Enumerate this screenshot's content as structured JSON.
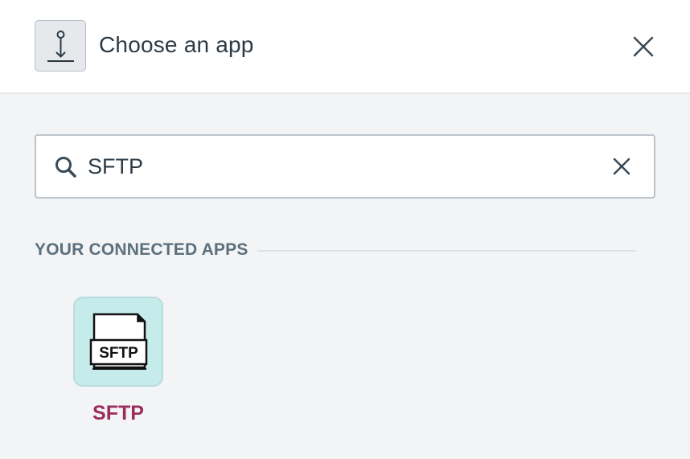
{
  "header": {
    "title": "Choose an app",
    "icon": "trigger-step-icon",
    "close_icon": "close-icon"
  },
  "search": {
    "value": "SFTP",
    "placeholder": "",
    "search_icon": "search-icon",
    "clear_icon": "clear-icon"
  },
  "connected_apps": {
    "heading": "YOUR CONNECTED APPS",
    "apps": [
      {
        "label": "SFTP",
        "logo_text": "SFTP",
        "icon": "sftp-file-icon"
      }
    ]
  },
  "colors": {
    "header_bg": "#ffffff",
    "page_bg": "#f3f4f6",
    "app_tile_bg": "#c6ebeb",
    "app_label": "#9b2d5c",
    "heading_text": "#5a707d"
  }
}
